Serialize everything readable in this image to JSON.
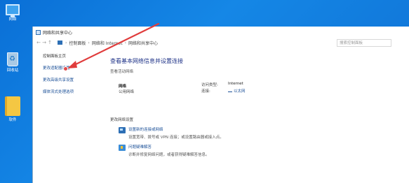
{
  "desktop": {
    "icons": [
      {
        "label": "网络",
        "icon": "network-icon"
      },
      {
        "label": "回收站",
        "icon": "recycle-bin-icon"
      },
      {
        "label": "软件",
        "icon": "folder-icon"
      }
    ]
  },
  "window": {
    "title": "网络和共享中心",
    "breadcrumbs": [
      "控制面板",
      "网络和 Internet",
      "网络和共享中心"
    ],
    "search_placeholder": "搜索控制面板"
  },
  "sidebar": {
    "items": [
      {
        "label": "控制面板主页"
      },
      {
        "label": "更改适配器设置"
      },
      {
        "label": "更改高级共享设置"
      },
      {
        "label": "媒体流式处理选项"
      }
    ]
  },
  "main": {
    "title": "查看基本网络信息并设置连接",
    "active_label": "查看活动网络",
    "network_name": "网络",
    "network_type": "公用网络",
    "access_type_label": "访问类型:",
    "access_type_value": "Internet",
    "connection_label": "连接:",
    "connection_value": "以太网",
    "change_label": "更改网络设置",
    "actions": [
      {
        "title": "设置新的连接或网络",
        "desc": "设置宽带、拨号或 VPN 连接；或设置路由器或接入点。",
        "icon": "network-wizard-icon"
      },
      {
        "title": "问题疑难解答",
        "desc": "诊断并修复网络问题，或者获得疑难解答信息。",
        "icon": "troubleshoot-icon"
      }
    ]
  },
  "annotation": {
    "color": "#e03c3c"
  }
}
